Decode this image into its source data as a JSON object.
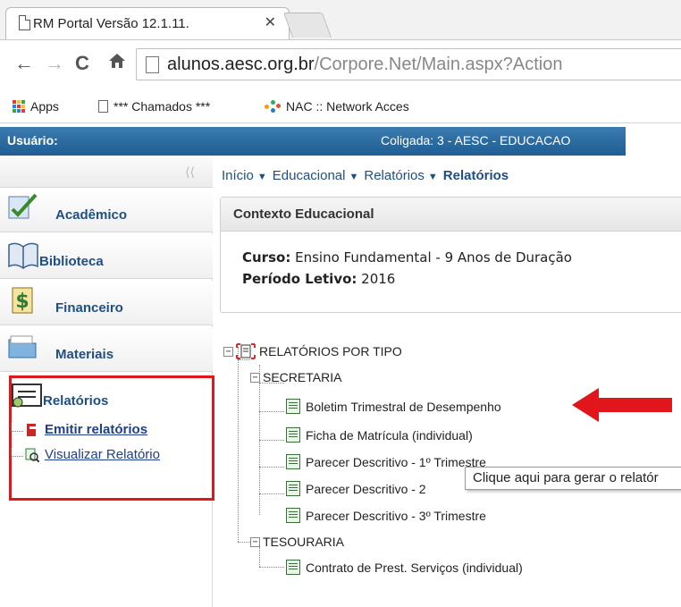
{
  "browser": {
    "tab_title": "RM Portal Versão 12.1.11.",
    "tab_close": "✕",
    "url_host": "alunos.aesc.org.br",
    "url_path": "/Corpore.Net/Main.aspx?Action",
    "bookmarks": [
      {
        "label": "Apps",
        "icon": "apps-grid-icon"
      },
      {
        "label": "*** Chamados ***",
        "icon": "page-icon"
      },
      {
        "label": "NAC :: Network Acces",
        "icon": "nac-icon"
      }
    ]
  },
  "header": {
    "user_label": "Usuário:",
    "coligada": "Coligada: 3 - AESC - EDUCACAO",
    "accent": "#2a6ca3"
  },
  "sidebar": {
    "collapse": "⟨⟨",
    "sections": [
      {
        "label": "Acadêmico",
        "icon": "academic-check-icon"
      },
      {
        "label": "Biblioteca",
        "icon": "book-icon"
      },
      {
        "label": "Financeiro",
        "icon": "money-icon"
      },
      {
        "label": "Materiais",
        "icon": "folder-icon"
      },
      {
        "label": "Relatórios",
        "icon": "report-icon"
      }
    ],
    "report_items": [
      {
        "label": "Emitir relatórios",
        "icon": "print-report-icon"
      },
      {
        "label": "Visualizar Relatório",
        "icon": "magnify-report-icon"
      }
    ],
    "highlight_color": "#e0161c"
  },
  "breadcrumb": {
    "items": [
      "Início",
      "Educacional",
      "Relatórios"
    ],
    "current": "Relatórios",
    "sep": "▼"
  },
  "context": {
    "title": "Contexto Educacional",
    "curso_label": "Curso:",
    "curso_value": " Ensino Fundamental - 9 Anos de Duração",
    "periodo_label": "Período Letivo:",
    "periodo_value": " 2016"
  },
  "tree": {
    "root": "RELATÓRIOS POR TIPO",
    "groups": [
      {
        "label": "SECRETARIA",
        "items": [
          "Boletim Trimestral de Desempenho",
          "Ficha de Matrícula (individual)",
          "Parecer Descritivo - 1º Trimestre",
          "Parecer Descritivo - 2",
          "Parecer Descritivo - 3º Trimestre"
        ]
      },
      {
        "label": "TESOURARIA",
        "items": [
          "Contrato de Prest. Serviços (individual)"
        ]
      }
    ],
    "expander": "−"
  },
  "tooltip": "Clique aqui para gerar o relatór",
  "arrow_color": "#e0161c"
}
